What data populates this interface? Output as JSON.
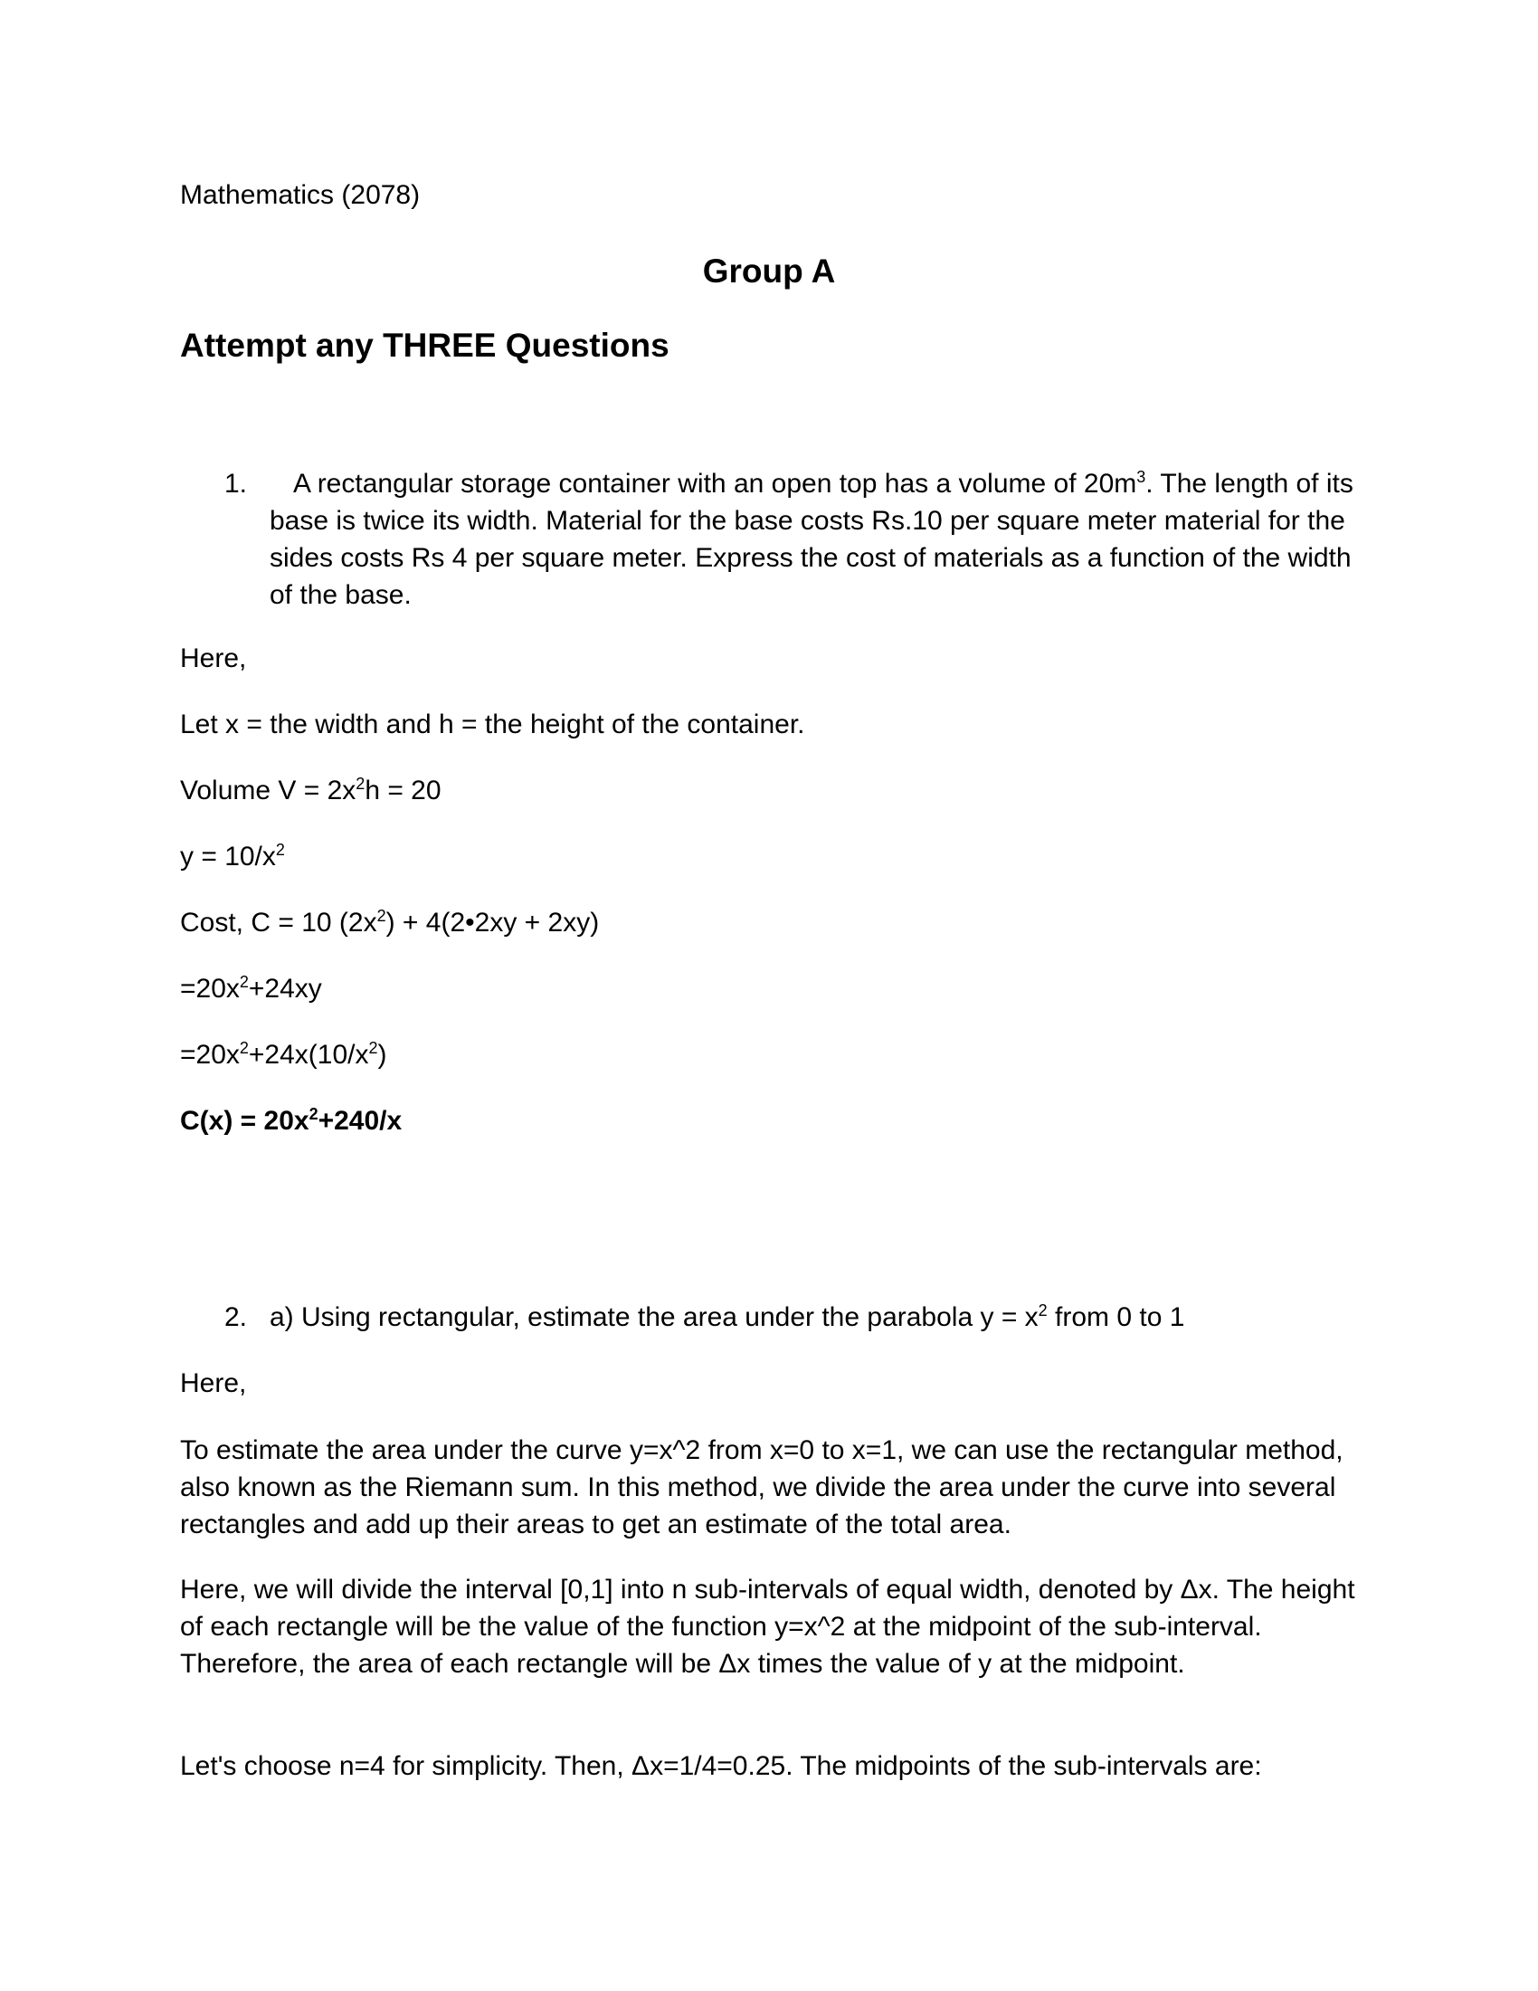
{
  "doc": {
    "header": "Mathematics (2078)",
    "group_title": "Group A",
    "instruction": "Attempt any THREE Questions"
  },
  "q1": {
    "number": "1.",
    "text_part1": "A rectangular storage container with an open top has a volume of 20m",
    "text_sup": "3",
    "text_part2": ". The length of its base is twice its width. Material for the base costs Rs.10 per square meter material for the sides costs Rs 4 per square meter. Express the cost of materials as a function of the width of the base.",
    "here": "Here,",
    "let": "Let x = the width and  h = the height of the container.",
    "volume_a": "Volume V = 2x",
    "volume_sup": "2",
    "volume_b": "h = 20",
    "y_a": "y = 10/x",
    "y_sup": "2",
    "cost_a": "Cost, C = 10 (2x",
    "cost_sup": "2",
    "cost_b": ") + 4(2•2xy + 2xy)",
    "step1_a": "=20x",
    "step1_sup": "2",
    "step1_b": "+24xy",
    "step2_a": "=20x",
    "step2_sup": "2",
    "step2_b": "+24x(10/x",
    "step2_sup2": "2",
    "step2_c": ")",
    "final_a": "C(x) = 20x",
    "final_sup": "2",
    "final_b": "+240/x"
  },
  "q2": {
    "number": "2.",
    "text_a": "a) Using rectangular, estimate the area under the parabola y = x",
    "text_sup": "2",
    "text_b": " from 0 to 1",
    "here": "Here,",
    "para1": " To estimate the area under the curve y=x^2 from x=0 to x=1, we can use the rectangular method, also known as the Riemann sum. In this method, we divide the area under the curve into several rectangles and add up their areas to get an estimate of the total area.",
    "para2": "Here, we will divide the interval [0,1] into n sub-intervals of equal width, denoted by Δx. The height of each rectangle will be the value of the function y=x^2 at the midpoint of the sub-interval. Therefore, the area of each rectangle will be Δx times the value of y at the midpoint.",
    "para3": "Let's choose n=4 for simplicity. Then, Δx=1/4=0.25. The midpoints of the sub-intervals are:"
  }
}
